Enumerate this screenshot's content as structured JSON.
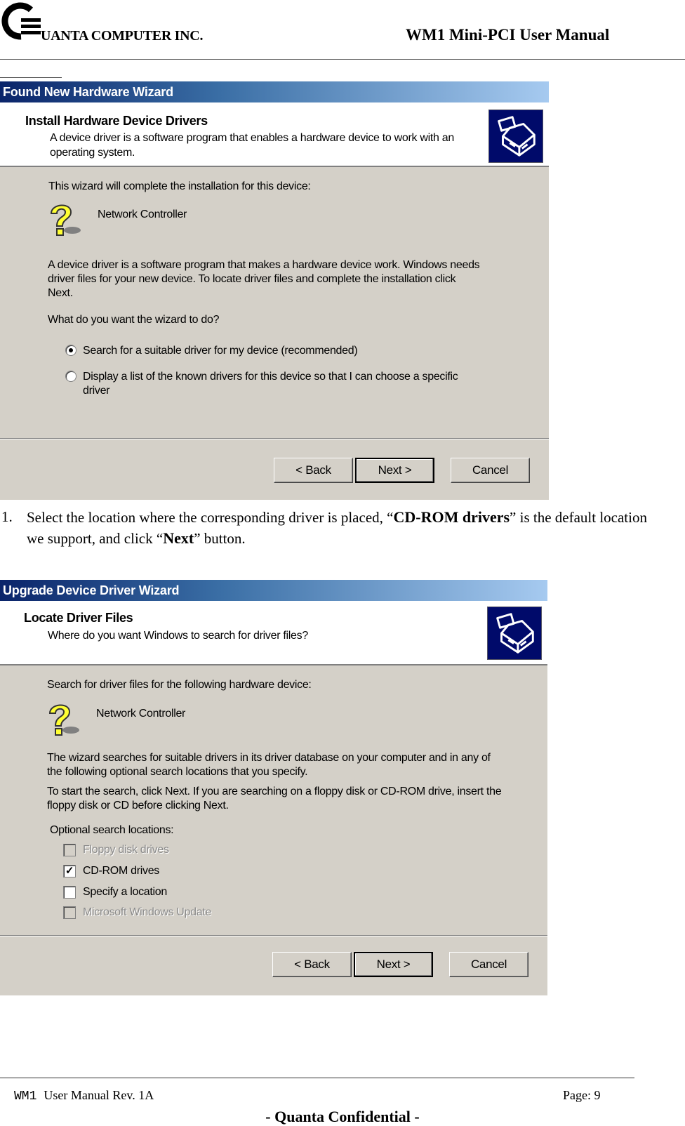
{
  "header": {
    "company": "UANTA COMPUTER INC.",
    "manual_title": "WM1 Mini-PCI User Manual",
    "logo_icon": "quanta-q-logo-icon"
  },
  "wizard1": {
    "title": "Found New Hardware Wizard",
    "head_title": "Install Hardware Device Drivers",
    "head_subtitle": "A device driver is a software program that enables a hardware device to work with an operating system.",
    "head_icon": "hardware-device-icon",
    "intro": "This wizard will complete the installation for this device:",
    "device_icon": "unknown-device-question-icon",
    "device_name": "Network Controller",
    "description": "A device driver is a software program that makes a hardware device work. Windows needs driver files for your new device. To locate driver files and complete the installation click Next.",
    "question": "What do you want the wizard to do?",
    "options": [
      {
        "label": "Search for a suitable driver for my device (recommended)",
        "selected": true
      },
      {
        "label": "Display a list of the known drivers for this device so that I can choose a specific driver",
        "selected": false
      }
    ],
    "buttons": {
      "back": "< Back",
      "next": "Next >",
      "cancel": "Cancel"
    }
  },
  "instruction": {
    "number": "1.",
    "text_part1": "Select the location where the corresponding driver is placed, “",
    "bold1": "CD-ROM drivers",
    "text_part2": "” is the default location we support, and click “",
    "bold2": "Next",
    "text_part3": "” button."
  },
  "wizard2": {
    "title": "Upgrade Device Driver Wizard",
    "head_title": "Locate Driver Files",
    "head_subtitle": "Where do you want Windows to search for driver files?",
    "head_icon": "hardware-device-icon",
    "intro": "Search for driver files for the following hardware device:",
    "device_icon": "unknown-device-question-icon",
    "device_name": "Network Controller",
    "description1": "The wizard searches for suitable drivers in its driver database on your computer and in any of the following optional search locations that you specify.",
    "description2": "To start the search, click Next. If you are searching on a floppy disk or CD-ROM drive, insert the floppy disk or CD before clicking Next.",
    "locations_label": "Optional search locations:",
    "locations": [
      {
        "label": "Floppy disk drives",
        "checked": false,
        "enabled": false
      },
      {
        "label": "CD-ROM drives",
        "checked": true,
        "enabled": true
      },
      {
        "label": "Specify a location",
        "checked": false,
        "enabled": true
      },
      {
        "label": "Microsoft Windows Update",
        "checked": false,
        "enabled": false
      }
    ],
    "buttons": {
      "back": "< Back",
      "next": "Next >",
      "cancel": "Cancel"
    }
  },
  "footer": {
    "model": "WM1",
    "revision": "User Manual Rev. 1A",
    "page": "Page: 9",
    "confidential": "- Quanta Confidential -"
  },
  "colors": {
    "dialog_bg": "#d4d0c8",
    "titlebar_start": "#0a246a",
    "titlebar_end": "#a6caf0",
    "icon_bg": "#000a6a"
  }
}
